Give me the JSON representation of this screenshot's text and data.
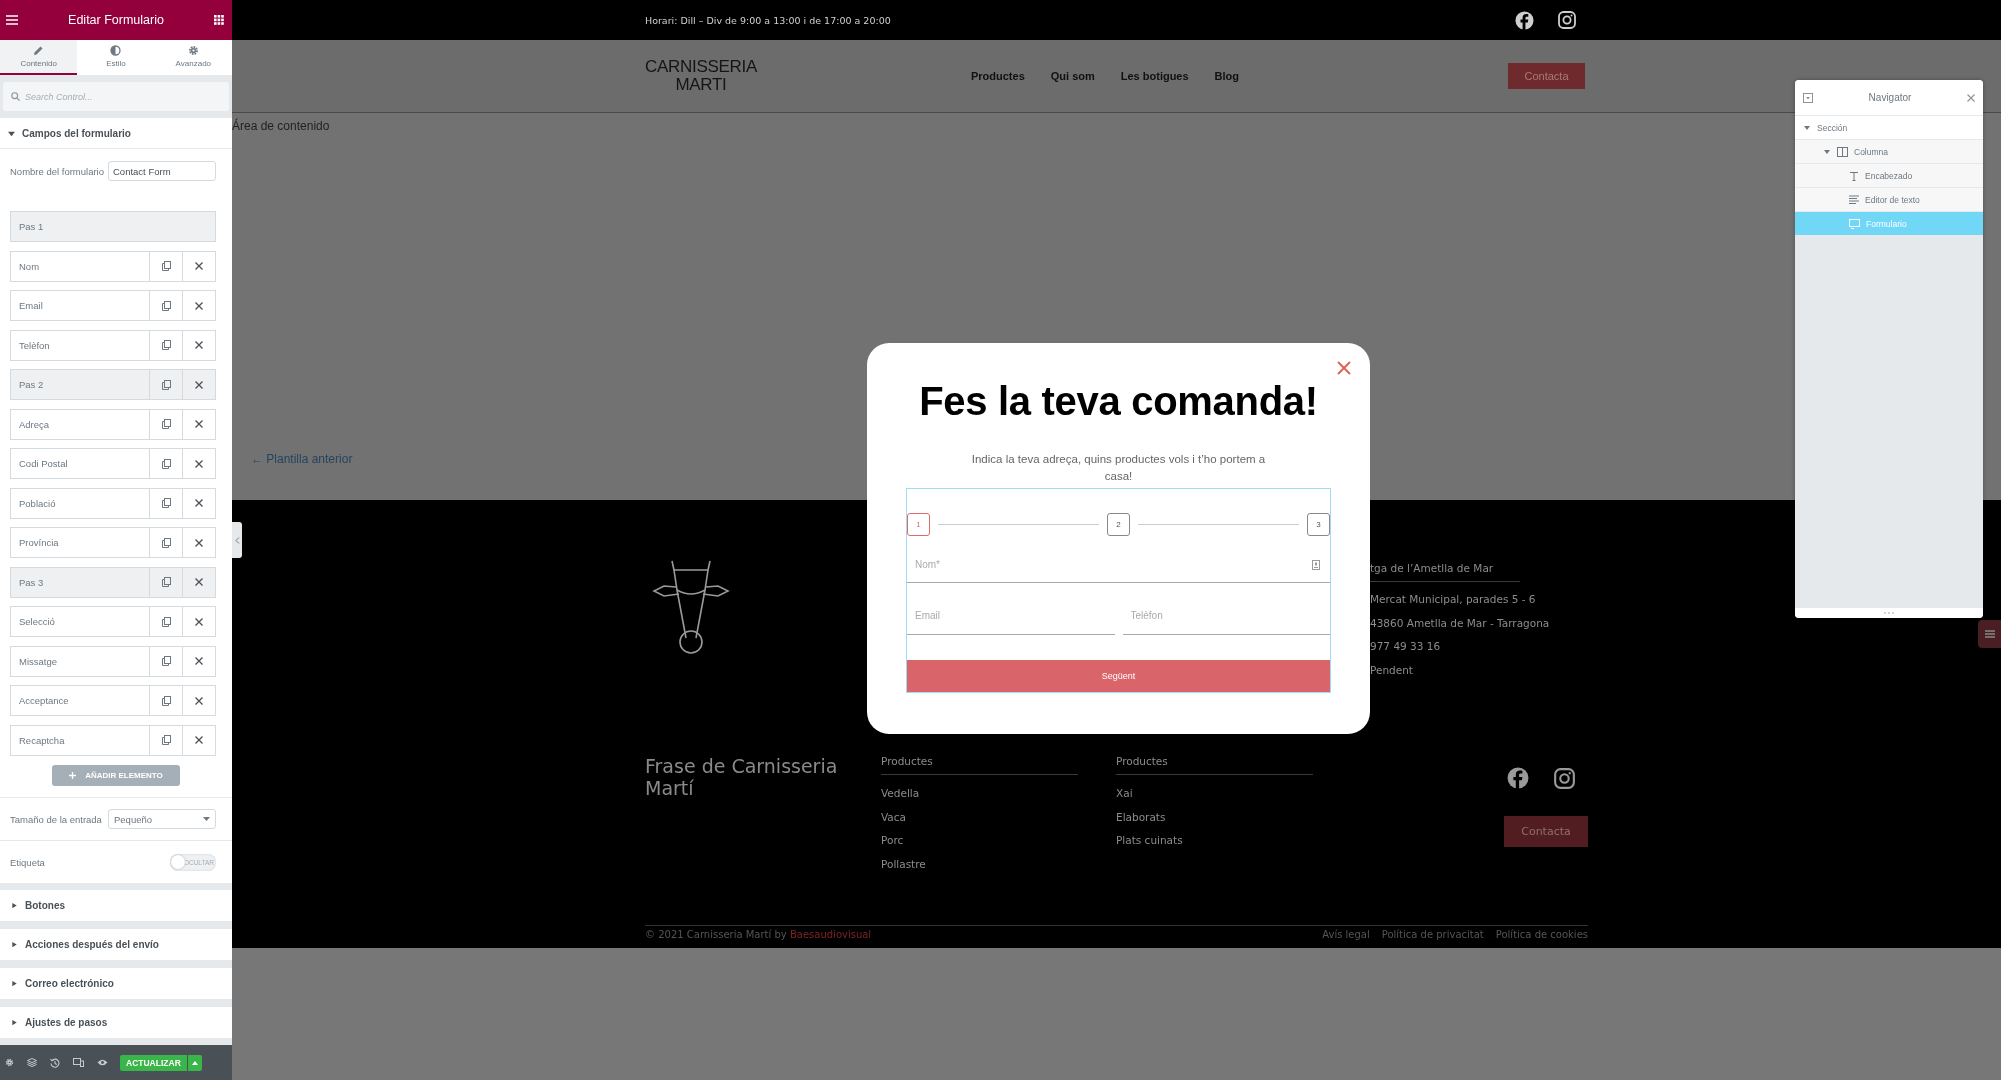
{
  "editor_panel": {
    "title": "Editar Formulario",
    "tabs": [
      {
        "label": "Contenido",
        "selected": true
      },
      {
        "label": "Estilo",
        "selected": false
      },
      {
        "label": "Avanzado",
        "selected": false
      }
    ],
    "search": {
      "placeholder": "Search Control..."
    },
    "section": {
      "title": "Campos del formulario",
      "expanded": true
    },
    "form_name": {
      "label": "Nombre del formulario",
      "value": "Contact Form"
    },
    "fields": [
      {
        "label": "Pas 1",
        "kind": "step",
        "actions": false
      },
      {
        "label": "Nom",
        "kind": "field",
        "actions": true
      },
      {
        "label": "Email",
        "kind": "field",
        "actions": true
      },
      {
        "label": "Telèfon",
        "kind": "field",
        "actions": true
      },
      {
        "label": "Pas 2",
        "kind": "step",
        "actions": true
      },
      {
        "label": "Adreça",
        "kind": "field",
        "actions": true
      },
      {
        "label": "Codi Postal",
        "kind": "field",
        "actions": true
      },
      {
        "label": "Població",
        "kind": "field",
        "actions": true
      },
      {
        "label": "Província",
        "kind": "field",
        "actions": true
      },
      {
        "label": "Pas 3",
        "kind": "step",
        "actions": true
      },
      {
        "label": "Selecció",
        "kind": "field",
        "actions": true
      },
      {
        "label": "Missatge",
        "kind": "field",
        "actions": true
      },
      {
        "label": "Acceptance",
        "kind": "field",
        "actions": true
      },
      {
        "label": "Recaptcha",
        "kind": "field",
        "actions": true
      }
    ],
    "add_button": "AÑADIR ELEMENTO",
    "input_size": {
      "label": "Tamaño de la entrada",
      "value": "Pequeño"
    },
    "label_toggle": {
      "label": "Etiqueta",
      "text": "OCULTAR",
      "on": false
    },
    "sections": [
      {
        "title": "Botones",
        "expanded": false
      },
      {
        "title": "Acciones después del envío",
        "expanded": false
      },
      {
        "title": "Correo electrónico",
        "expanded": false
      },
      {
        "title": "Ajustes de pasos",
        "expanded": false
      }
    ],
    "update_button": "ACTUALIZAR"
  },
  "page": {
    "top_bar": {
      "hours": "Horari: Dill – Div de 9:00 a 13:00 i de 17:00 a 20:00"
    },
    "header": {
      "logo_lines": [
        "CARNISSERIA",
        "MARTI"
      ],
      "nav": [
        "Productes",
        "Qui som",
        "Les botigues",
        "Blog"
      ],
      "cta": "Contacta"
    },
    "content_area_label": "Área de contenido",
    "prev_template": "← Plantilla anterior",
    "footer": {
      "address_title": "tga de l’Ametlla de Mar",
      "address_lines": [
        "Mercat Municipal, parades 5 - 6",
        "43860 Ametlla de Mar - Tarragona",
        "977 49 33 16",
        "Pendent"
      ],
      "phrase": "Frase de Carnisseria Martí",
      "columns": [
        {
          "title": "Productes",
          "items": [
            "Vedella",
            "Vaca",
            "Porc",
            "Pollastre"
          ]
        },
        {
          "title": "Productes",
          "items": [
            "Xai",
            "Elaborats",
            "Plats cuinats"
          ]
        }
      ],
      "cta": "Contacta",
      "copyright": "© 2021 Carnisseria Martí by",
      "credit": "Baesaudiovisual",
      "legal_links": [
        "Avís legal",
        "Política de privacitat",
        "Política de cookies"
      ]
    }
  },
  "modal": {
    "title": "Fes la teva comanda!",
    "subtitle": "Indica la teva adreça, quins productes vols i t’ho portem a casa!",
    "steps": [
      {
        "label": "1",
        "selected": true
      },
      {
        "label": "2",
        "selected": false
      },
      {
        "label": "3",
        "selected": false
      }
    ],
    "fields": [
      {
        "placeholder": "Nom*"
      },
      {
        "placeholder": "Email"
      },
      {
        "placeholder": "Telèfon"
      }
    ],
    "submit": "Següent"
  },
  "navigator": {
    "title": "Navigator",
    "tree": [
      {
        "label": "Sección",
        "kind": "section",
        "expanded": true,
        "selected": false,
        "children": [
          {
            "label": "Columna",
            "kind": "column",
            "expanded": true,
            "selected": false,
            "children": [
              {
                "label": "Encabezado",
                "kind": "heading",
                "selected": false
              },
              {
                "label": "Editor de texto",
                "kind": "text",
                "selected": false
              },
              {
                "label": "Formulario",
                "kind": "form",
                "selected": true
              }
            ]
          }
        ]
      }
    ]
  }
}
